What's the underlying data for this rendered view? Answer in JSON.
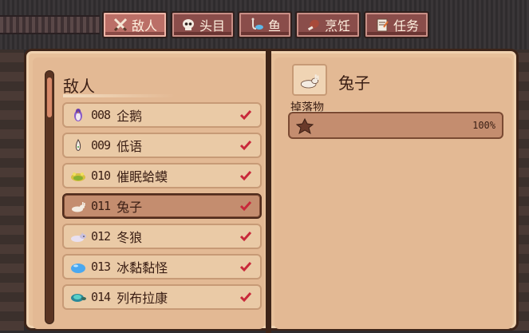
{
  "tabs": [
    {
      "label": "敌人",
      "icon": "crossed-swords-icon",
      "active": true
    },
    {
      "label": "头目",
      "icon": "skull-icon",
      "active": false
    },
    {
      "label": "鱼",
      "icon": "fish-hook-icon",
      "active": false
    },
    {
      "label": "烹饪",
      "icon": "meat-icon",
      "active": false
    },
    {
      "label": "任务",
      "icon": "quest-scroll-icon",
      "active": false
    }
  ],
  "left_page": {
    "title": "敌人",
    "entries": [
      {
        "number": "008",
        "name": "企鹅",
        "icon": "penguin-icon",
        "collected": true,
        "selected": false
      },
      {
        "number": "009",
        "name": "低语",
        "icon": "whisper-icon",
        "collected": true,
        "selected": false
      },
      {
        "number": "010",
        "name": "催眠蛤蟆",
        "icon": "toad-icon",
        "collected": true,
        "selected": false
      },
      {
        "number": "011",
        "name": "兔子",
        "icon": "rabbit-icon",
        "collected": true,
        "selected": true
      },
      {
        "number": "012",
        "name": "冬狼",
        "icon": "wolf-icon",
        "collected": true,
        "selected": false
      },
      {
        "number": "013",
        "name": "冰黏黏怪",
        "icon": "ice-slime-icon",
        "collected": true,
        "selected": false
      },
      {
        "number": "014",
        "name": "列布拉康",
        "icon": "turtle-icon",
        "collected": true,
        "selected": false
      }
    ]
  },
  "right_page": {
    "name": "兔子",
    "icon": "rabbit-icon",
    "drops_label": "掉落物",
    "drops": [
      {
        "icon": "star-leather-icon",
        "chance": "100%"
      }
    ]
  },
  "colors": {
    "page": "#e3b994",
    "row": "#eacaa6",
    "selected_row": "#c48d6f",
    "check": "#c8283a",
    "tab": "#8a4d4a"
  }
}
